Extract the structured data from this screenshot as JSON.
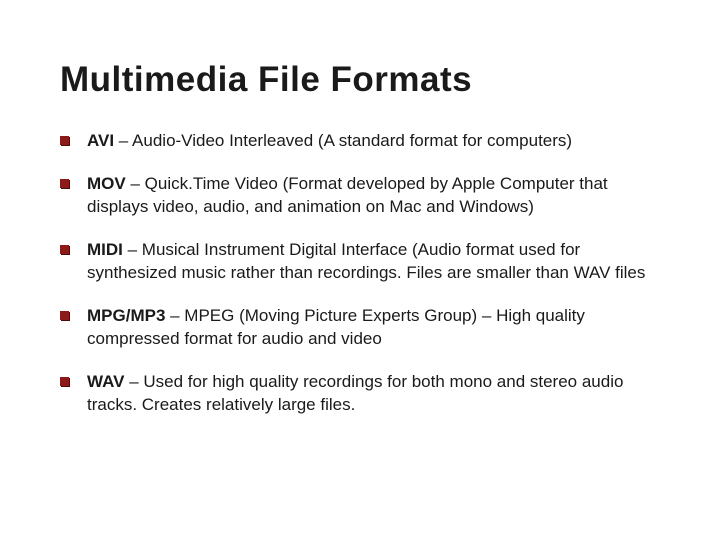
{
  "title": "Multimedia File Formats",
  "items": [
    {
      "bold": "AVI",
      "rest": " – Audio-Video Interleaved (A standard format for computers)"
    },
    {
      "bold": "MOV",
      "rest": " – Quick.Time Video (Format developed by Apple Computer that displays video, audio, and animation on Mac and Windows)"
    },
    {
      "bold": "MIDI",
      "rest": " – Musical Instrument Digital Interface (Audio format used for synthesized music rather than recordings.  Files are smaller than WAV files"
    },
    {
      "bold": "MPG/MP3",
      "rest": " – MPEG (Moving Picture Experts Group) – High quality compressed format for audio and video"
    },
    {
      "bold": "WAV",
      "rest": " – Used for high quality recordings for both mono and stereo audio tracks.  Creates relatively large files."
    }
  ]
}
